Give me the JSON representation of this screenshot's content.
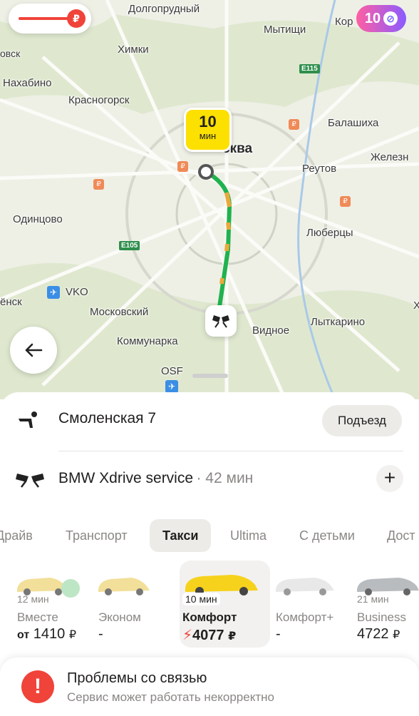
{
  "map": {
    "eta_value": "10",
    "eta_unit": "мин",
    "promo_badge": "10",
    "places": [
      "Долгопрудный",
      "Мытищи",
      "Кор",
      "Химки",
      "овск",
      "E115",
      "Нахабино",
      "Красногорск",
      "Балашиха",
      "Железн",
      "10",
      "мин",
      "сква",
      "Реутов",
      "Одинцово",
      "Люберцы",
      "E105",
      "VKO",
      "Московский",
      "ёнск",
      "Видное",
      "Лыткарино",
      "Коммунарка",
      "OSF",
      "Х"
    ]
  },
  "route": {
    "from": "Смоленская 7",
    "entrance_button": "Подъезд",
    "to": "BMW Xdrive service",
    "to_duration": "· 42 мин",
    "add_stop": "+"
  },
  "tabs": [
    "Драйв",
    "Транспорт",
    "Такси",
    "Ultima",
    "С детьми",
    "Дост"
  ],
  "active_tab": "Такси",
  "tariffs": [
    {
      "eta": "12 мин",
      "name": "Вместе",
      "price_prefix": "от",
      "price": "1410",
      "currency": "₽",
      "car_color": "#f2df9a"
    },
    {
      "eta": "",
      "name": "Эконом",
      "price_prefix": "",
      "price": "-",
      "currency": "",
      "car_color": "#f2df9a"
    },
    {
      "eta": "10 мин",
      "name": "Комфорт",
      "price_prefix": "⚡",
      "price": "4077",
      "currency": "₽",
      "car_color": "#f6d21c"
    },
    {
      "eta": "",
      "name": "Комфорт+",
      "price_prefix": "",
      "price": "-",
      "currency": "",
      "car_color": "#e8e8e8"
    },
    {
      "eta": "21 мин",
      "name": "Business",
      "price_prefix": "",
      "price": "4722",
      "currency": "₽",
      "car_color": "#b9bcbf"
    }
  ],
  "banner": {
    "title": "Проблемы со связью",
    "subtitle": "Сервис может работать некорректно"
  },
  "colors": {
    "accent_yellow": "#fce000",
    "route_green": "#21c05a",
    "alert_red": "#f0433a"
  }
}
